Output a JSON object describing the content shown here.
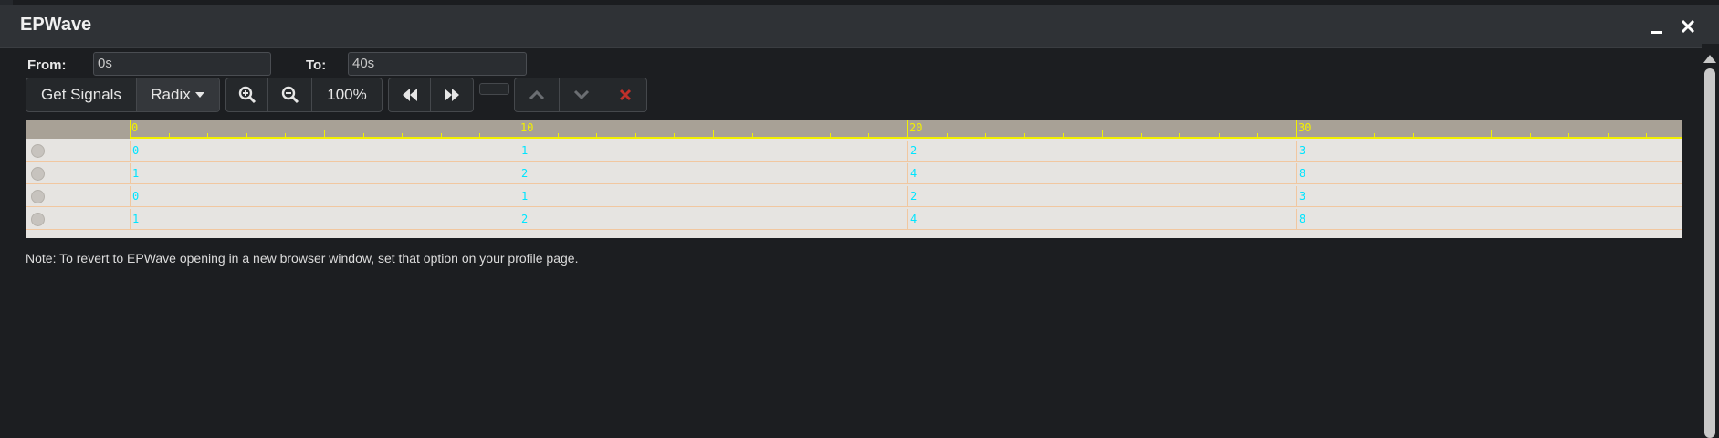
{
  "window": {
    "title": "EPWave"
  },
  "controls": {
    "from_label": "From:",
    "from_value": "0s",
    "to_label": "To:",
    "to_value": "40s"
  },
  "toolbar": {
    "get_signals": "Get Signals",
    "radix": "Radix",
    "zoom_level": "100%"
  },
  "ruler": {
    "labels": [
      "0",
      "10",
      "20",
      "30"
    ]
  },
  "signals": [
    {
      "values": [
        "0",
        "1",
        "2",
        "3"
      ]
    },
    {
      "values": [
        "1",
        "2",
        "4",
        "8"
      ]
    },
    {
      "values": [
        "0",
        "1",
        "2",
        "3"
      ]
    },
    {
      "values": [
        "1",
        "2",
        "4",
        "8"
      ]
    }
  ],
  "note": "Note: To revert to EPWave opening in a new browser window, set that option on your profile page.",
  "colors": {
    "ruler_bg": "#a8a196",
    "ruler_tick": "#f2f000",
    "value_text": "#00e5ff",
    "wave_bg": "#e6e4e1",
    "cancel_red": "#c0302a"
  },
  "icons": [
    "zoom-in-icon",
    "zoom-out-icon",
    "rewind-icon",
    "fast-forward-icon",
    "chevron-up-icon",
    "chevron-down-icon",
    "close-icon",
    "caret-down-icon"
  ]
}
